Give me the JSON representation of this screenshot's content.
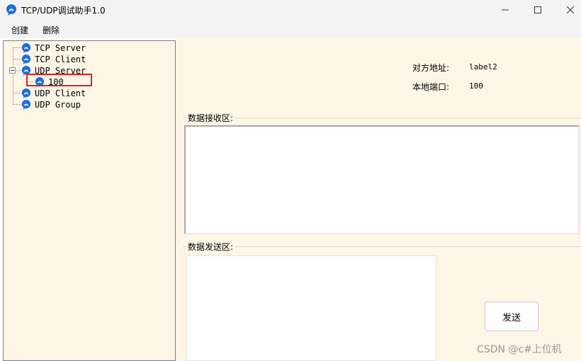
{
  "window": {
    "title": "TCP/UDP调试助手1.0",
    "icon": "phone-bubble-icon"
  },
  "menu": {
    "create": "创建",
    "delete": "删除"
  },
  "tree": {
    "items": [
      {
        "label": "TCP Server"
      },
      {
        "label": "TCP Client"
      },
      {
        "label": "UDP Server",
        "expanded": true
      },
      {
        "label": "100",
        "selected": true
      },
      {
        "label": "UDP Client"
      },
      {
        "label": "UDP Group"
      }
    ]
  },
  "info": {
    "remote_address_label": "对方地址:",
    "remote_address_value": "label2",
    "local_port_label": "本地端口:",
    "local_port_value": "100"
  },
  "receive": {
    "title": "数据接收区:",
    "content": ""
  },
  "send": {
    "title": "数据发送区:",
    "content": "",
    "button_label": "发送"
  },
  "watermark": "CSDN @c#上位机",
  "colors": {
    "panel_background": "#fdf5e6",
    "icon_blue": "#1e6fd9",
    "highlight_red": "#e02020"
  }
}
